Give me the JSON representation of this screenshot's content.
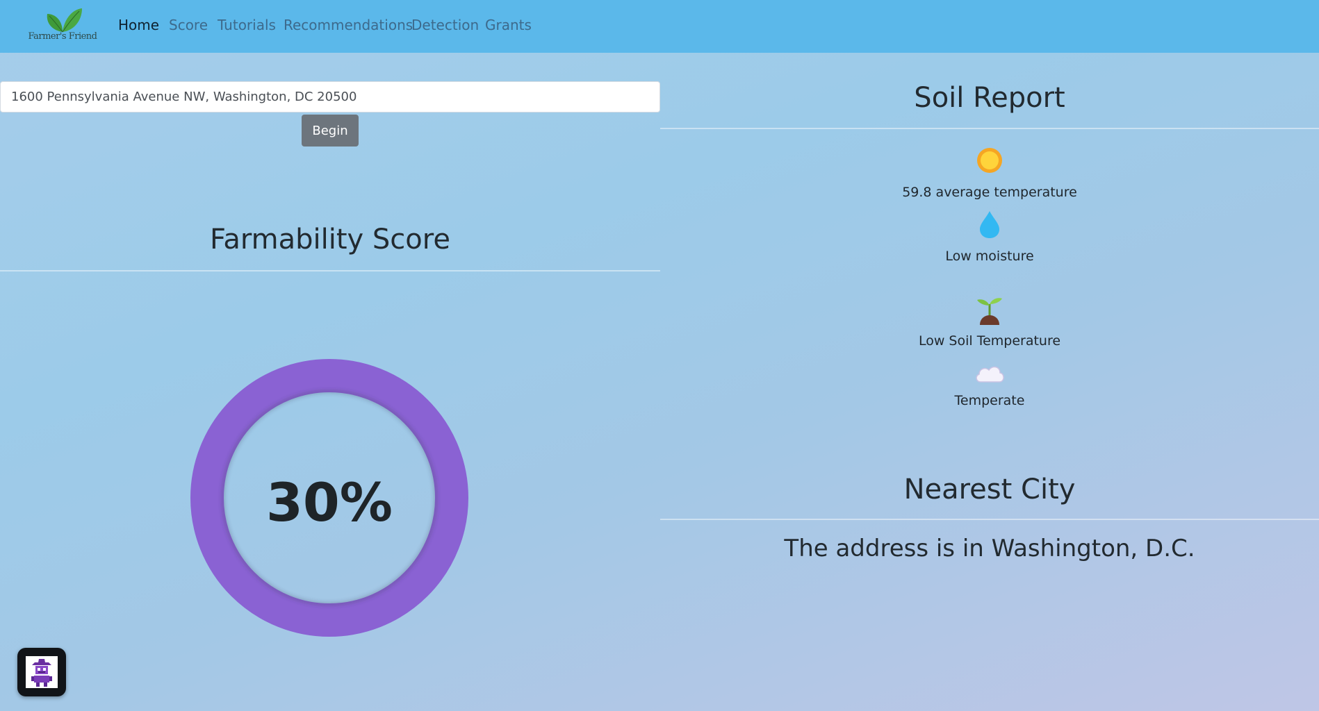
{
  "brand": {
    "name": "Farmer's Friend",
    "leaf_color": "#3f9a3a"
  },
  "nav": {
    "items": [
      {
        "label": "Home",
        "active": true
      },
      {
        "label": "Score",
        "active": false
      },
      {
        "label": "Tutorials",
        "active": false
      },
      {
        "label": "Recommendations",
        "active": false
      },
      {
        "label": "Detection",
        "active": false
      },
      {
        "label": "Grants",
        "active": false
      }
    ]
  },
  "search": {
    "value": "1600 Pennsylvania Avenue NW, Washington, DC 20500",
    "button_label": "Begin"
  },
  "score": {
    "title": "Farmability Score",
    "value_text": "30%",
    "ring_color": "#8a62d3"
  },
  "soil_report": {
    "title": "Soil Report",
    "items": [
      {
        "icon": "sun-icon",
        "label": "59.8 average temperature"
      },
      {
        "icon": "water-drop-icon",
        "label": "Low moisture"
      },
      {
        "icon": "seedling-icon",
        "label": "Low Soil Temperature"
      },
      {
        "icon": "cloud-icon",
        "label": "Temperate"
      }
    ]
  },
  "nearest_city": {
    "title": "Nearest City",
    "text": "The address is in Washington, D.C."
  },
  "colors": {
    "navbar": "#5bb8ea",
    "button": "#6d757d"
  }
}
